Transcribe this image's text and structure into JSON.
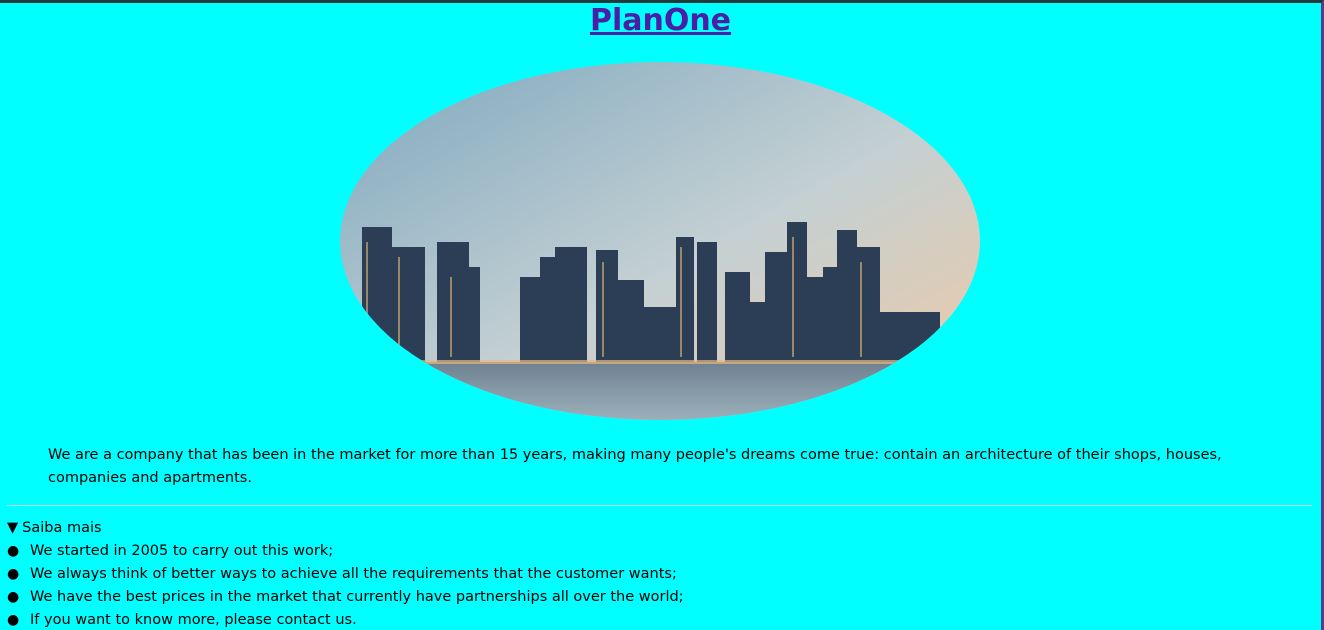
{
  "header": {
    "title": "PlanOne"
  },
  "hero": {
    "image_alt": "city-skyline"
  },
  "intro": {
    "text": "We are a company that has been in the market for more than 15 years, making many people's dreams come true: contain an architecture of their shops, houses, companies and apartments."
  },
  "details": {
    "toggle_icon": "▼",
    "summary": "Saiba mais",
    "items": [
      "We started in 2005 to carry out this work;",
      "We always think of better ways to achieve all the requirements that the customer wants;",
      "We have the best prices in the market that currently have partnerships all over the world;",
      "If you want to know more, please contact us."
    ]
  },
  "colors": {
    "background": "#00ffff",
    "title": "#4a1fa8"
  }
}
